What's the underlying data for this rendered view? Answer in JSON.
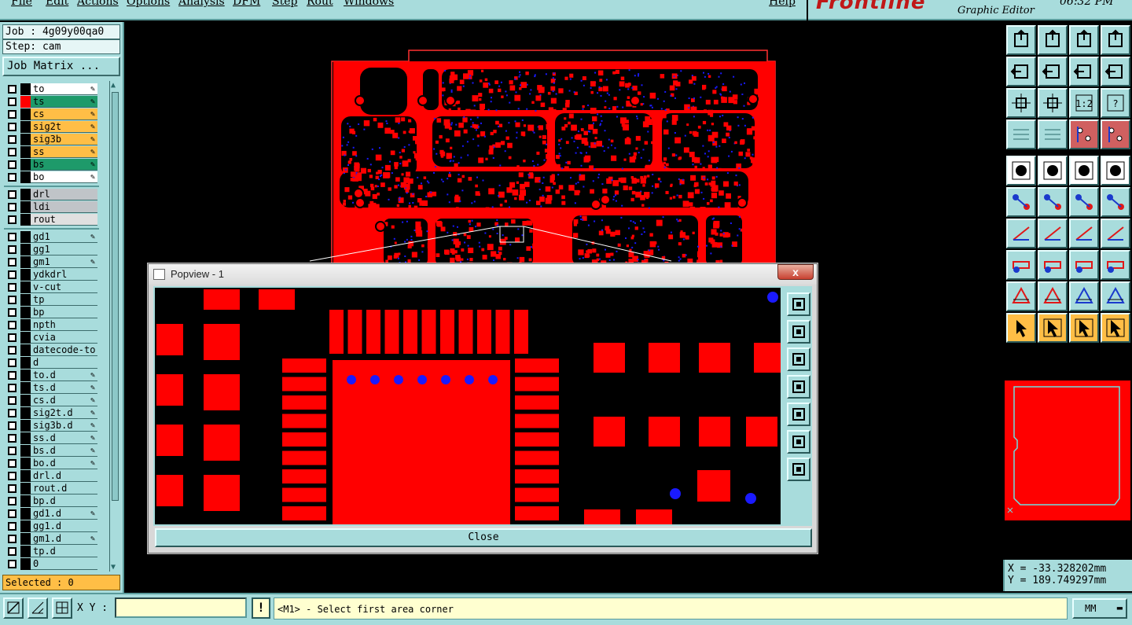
{
  "menu": {
    "items": [
      "File",
      "Edit",
      "Actions",
      "Options",
      "Analysis",
      "DFM",
      "Step",
      "Rout",
      "Windows",
      "Help"
    ]
  },
  "brand": {
    "logo": "Frontline",
    "subtitle": "Graphic Editor",
    "clock": "06:32 PM"
  },
  "left_panel": {
    "job_label": "Job : 4g09y00qa0",
    "step_label": "Step: cam",
    "job_matrix_button": "Job Matrix ...",
    "selected_label": "Selected : 0",
    "layers": [
      {
        "name": "to",
        "color": "#ffffff",
        "swatch": "#000000",
        "pen": true
      },
      {
        "name": "ts",
        "color": "#1e9a6a",
        "swatch": "#ff0000",
        "pen": true
      },
      {
        "name": "cs",
        "color": "#ffbe46",
        "swatch": "#000000",
        "pen": true
      },
      {
        "name": "sig2t",
        "color": "#ffbe46",
        "swatch": "#000000",
        "pen": true
      },
      {
        "name": "sig3b",
        "color": "#ffbe46",
        "swatch": "#000000",
        "pen": true
      },
      {
        "name": "ss",
        "color": "#ffbe46",
        "swatch": "#000000",
        "pen": true
      },
      {
        "name": "bs",
        "color": "#1e9a6a",
        "swatch": "#000000",
        "pen": true
      },
      {
        "name": "bo",
        "color": "#ffffff",
        "swatch": "#000000",
        "pen": true
      },
      {
        "name": "drl",
        "color": "#c0c4c8",
        "swatch": "#000000",
        "pen": false
      },
      {
        "name": "ldi",
        "color": "#c0c4c8",
        "swatch": "#000000",
        "pen": false
      },
      {
        "name": "rout",
        "color": "#e0e0e0",
        "swatch": "#000000",
        "pen": false
      },
      {
        "name": "gd1",
        "color": "#a8dcdc",
        "swatch": "#000000",
        "pen": true
      },
      {
        "name": "gg1",
        "color": "#a8dcdc",
        "swatch": "#000000",
        "pen": false
      },
      {
        "name": "gm1",
        "color": "#a8dcdc",
        "swatch": "#000000",
        "pen": true
      },
      {
        "name": "ydkdrl",
        "color": "#a8dcdc",
        "swatch": "#000000",
        "pen": false
      },
      {
        "name": "v-cut",
        "color": "#a8dcdc",
        "swatch": "#000000",
        "pen": false
      },
      {
        "name": "tp",
        "color": "#a8dcdc",
        "swatch": "#000000",
        "pen": false
      },
      {
        "name": "bp",
        "color": "#a8dcdc",
        "swatch": "#000000",
        "pen": false
      },
      {
        "name": "npth",
        "color": "#a8dcdc",
        "swatch": "#000000",
        "pen": false
      },
      {
        "name": "cvia",
        "color": "#a8dcdc",
        "swatch": "#000000",
        "pen": false
      },
      {
        "name": "datecode-to",
        "color": "#a8dcdc",
        "swatch": "#000000",
        "pen": false
      },
      {
        "name": "d",
        "color": "#a8dcdc",
        "swatch": "#000000",
        "pen": false
      },
      {
        "name": "to.d",
        "color": "#a8dcdc",
        "swatch": "#000000",
        "pen": true
      },
      {
        "name": "ts.d",
        "color": "#a8dcdc",
        "swatch": "#000000",
        "pen": true
      },
      {
        "name": "cs.d",
        "color": "#a8dcdc",
        "swatch": "#000000",
        "pen": true
      },
      {
        "name": "sig2t.d",
        "color": "#a8dcdc",
        "swatch": "#000000",
        "pen": true
      },
      {
        "name": "sig3b.d",
        "color": "#a8dcdc",
        "swatch": "#000000",
        "pen": true
      },
      {
        "name": "ss.d",
        "color": "#a8dcdc",
        "swatch": "#000000",
        "pen": true
      },
      {
        "name": "bs.d",
        "color": "#a8dcdc",
        "swatch": "#000000",
        "pen": true
      },
      {
        "name": "bo.d",
        "color": "#a8dcdc",
        "swatch": "#000000",
        "pen": true
      },
      {
        "name": "drl.d",
        "color": "#a8dcdc",
        "swatch": "#000000",
        "pen": false
      },
      {
        "name": "rout.d",
        "color": "#a8dcdc",
        "swatch": "#000000",
        "pen": false
      },
      {
        "name": "bp.d",
        "color": "#a8dcdc",
        "swatch": "#000000",
        "pen": false
      },
      {
        "name": "gd1.d",
        "color": "#a8dcdc",
        "swatch": "#000000",
        "pen": true
      },
      {
        "name": "gg1.d",
        "color": "#a8dcdc",
        "swatch": "#000000",
        "pen": false
      },
      {
        "name": "gm1.d",
        "color": "#a8dcdc",
        "swatch": "#000000",
        "pen": true
      },
      {
        "name": "tp.d",
        "color": "#a8dcdc",
        "swatch": "#000000",
        "pen": false
      },
      {
        "name": "0",
        "color": "#a8dcdc",
        "swatch": "#000000",
        "pen": false
      }
    ]
  },
  "popview": {
    "title": "Popview - 1",
    "close_x": "x",
    "close_button": "Close",
    "tool_icons": [
      "zoom-window-icon",
      "pan-up-icon",
      "pan-down-icon",
      "pan-left-icon",
      "pan-right-icon",
      "zoom-out-icon",
      "zoom-in-icon"
    ]
  },
  "toolbar": {
    "icons": [
      "save-up-icon",
      "save-down-icon",
      "home-icon",
      "window-icon",
      "pan-left-icon",
      "pan-right-icon",
      "redraw-icon",
      "layout-icon",
      "zoom-fit-icon",
      "zoom-center-icon",
      "zoom-1to1-icon",
      "help-icon",
      "tool-settings-icon",
      "grid-icon",
      "layer-stack-red-icon",
      "layer-stack-icon",
      "select-feature-icon",
      "measure-line-icon",
      "ruler-icon",
      "pad-icon",
      "connect-nodes-icon",
      "delete-node-icon",
      "snap-point-icon",
      "snap-end-icon",
      "angle-icon",
      "line-snap-icon",
      "rotate-icon",
      "mirror-text-icon",
      "pad-net-icon",
      "trace-icon",
      "dimension-icon",
      "shape-icon",
      "triangle-red-icon",
      "triangle-red-2-icon",
      "triangle-blue-icon",
      "triangle-blue-2-icon",
      "pointer-icon",
      "pointer-box-icon",
      "pointer-circle-icon",
      "pointer-net-icon"
    ]
  },
  "coords": {
    "x": "X = -33.328202mm",
    "y": "Y = 189.749297mm"
  },
  "statusbar": {
    "xy_label": "X Y :",
    "xy_value": "",
    "bang": "!",
    "prompt": "<M1> - Select first area corner",
    "units": "MM"
  },
  "colors": {
    "panel": "#a8dcdc",
    "copper": "#ff0000",
    "via": "#1a1aff",
    "canvas": "#000000"
  }
}
